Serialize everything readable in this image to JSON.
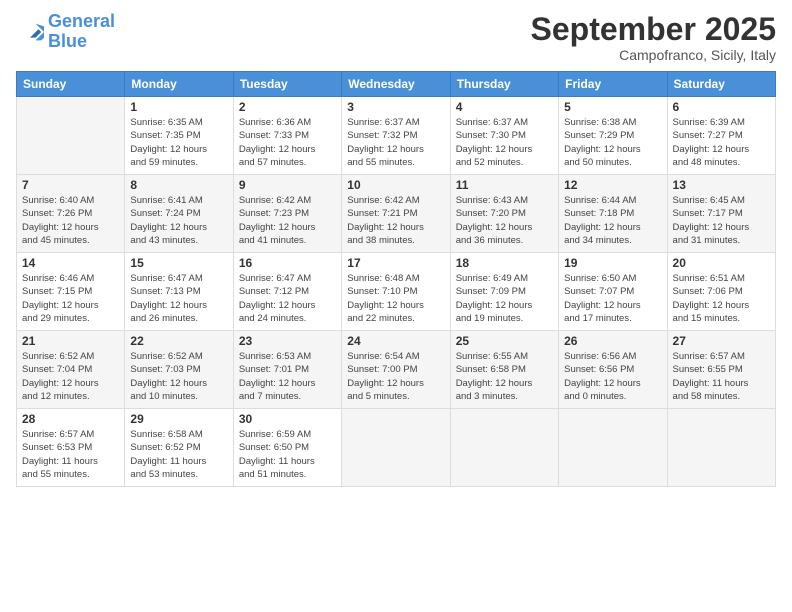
{
  "logo": {
    "line1": "General",
    "line2": "Blue"
  },
  "title": "September 2025",
  "location": "Campofranco, Sicily, Italy",
  "days_header": [
    "Sunday",
    "Monday",
    "Tuesday",
    "Wednesday",
    "Thursday",
    "Friday",
    "Saturday"
  ],
  "weeks": [
    [
      {
        "num": "",
        "info": ""
      },
      {
        "num": "1",
        "info": "Sunrise: 6:35 AM\nSunset: 7:35 PM\nDaylight: 12 hours\nand 59 minutes."
      },
      {
        "num": "2",
        "info": "Sunrise: 6:36 AM\nSunset: 7:33 PM\nDaylight: 12 hours\nand 57 minutes."
      },
      {
        "num": "3",
        "info": "Sunrise: 6:37 AM\nSunset: 7:32 PM\nDaylight: 12 hours\nand 55 minutes."
      },
      {
        "num": "4",
        "info": "Sunrise: 6:37 AM\nSunset: 7:30 PM\nDaylight: 12 hours\nand 52 minutes."
      },
      {
        "num": "5",
        "info": "Sunrise: 6:38 AM\nSunset: 7:29 PM\nDaylight: 12 hours\nand 50 minutes."
      },
      {
        "num": "6",
        "info": "Sunrise: 6:39 AM\nSunset: 7:27 PM\nDaylight: 12 hours\nand 48 minutes."
      }
    ],
    [
      {
        "num": "7",
        "info": "Sunrise: 6:40 AM\nSunset: 7:26 PM\nDaylight: 12 hours\nand 45 minutes."
      },
      {
        "num": "8",
        "info": "Sunrise: 6:41 AM\nSunset: 7:24 PM\nDaylight: 12 hours\nand 43 minutes."
      },
      {
        "num": "9",
        "info": "Sunrise: 6:42 AM\nSunset: 7:23 PM\nDaylight: 12 hours\nand 41 minutes."
      },
      {
        "num": "10",
        "info": "Sunrise: 6:42 AM\nSunset: 7:21 PM\nDaylight: 12 hours\nand 38 minutes."
      },
      {
        "num": "11",
        "info": "Sunrise: 6:43 AM\nSunset: 7:20 PM\nDaylight: 12 hours\nand 36 minutes."
      },
      {
        "num": "12",
        "info": "Sunrise: 6:44 AM\nSunset: 7:18 PM\nDaylight: 12 hours\nand 34 minutes."
      },
      {
        "num": "13",
        "info": "Sunrise: 6:45 AM\nSunset: 7:17 PM\nDaylight: 12 hours\nand 31 minutes."
      }
    ],
    [
      {
        "num": "14",
        "info": "Sunrise: 6:46 AM\nSunset: 7:15 PM\nDaylight: 12 hours\nand 29 minutes."
      },
      {
        "num": "15",
        "info": "Sunrise: 6:47 AM\nSunset: 7:13 PM\nDaylight: 12 hours\nand 26 minutes."
      },
      {
        "num": "16",
        "info": "Sunrise: 6:47 AM\nSunset: 7:12 PM\nDaylight: 12 hours\nand 24 minutes."
      },
      {
        "num": "17",
        "info": "Sunrise: 6:48 AM\nSunset: 7:10 PM\nDaylight: 12 hours\nand 22 minutes."
      },
      {
        "num": "18",
        "info": "Sunrise: 6:49 AM\nSunset: 7:09 PM\nDaylight: 12 hours\nand 19 minutes."
      },
      {
        "num": "19",
        "info": "Sunrise: 6:50 AM\nSunset: 7:07 PM\nDaylight: 12 hours\nand 17 minutes."
      },
      {
        "num": "20",
        "info": "Sunrise: 6:51 AM\nSunset: 7:06 PM\nDaylight: 12 hours\nand 15 minutes."
      }
    ],
    [
      {
        "num": "21",
        "info": "Sunrise: 6:52 AM\nSunset: 7:04 PM\nDaylight: 12 hours\nand 12 minutes."
      },
      {
        "num": "22",
        "info": "Sunrise: 6:52 AM\nSunset: 7:03 PM\nDaylight: 12 hours\nand 10 minutes."
      },
      {
        "num": "23",
        "info": "Sunrise: 6:53 AM\nSunset: 7:01 PM\nDaylight: 12 hours\nand 7 minutes."
      },
      {
        "num": "24",
        "info": "Sunrise: 6:54 AM\nSunset: 7:00 PM\nDaylight: 12 hours\nand 5 minutes."
      },
      {
        "num": "25",
        "info": "Sunrise: 6:55 AM\nSunset: 6:58 PM\nDaylight: 12 hours\nand 3 minutes."
      },
      {
        "num": "26",
        "info": "Sunrise: 6:56 AM\nSunset: 6:56 PM\nDaylight: 12 hours\nand 0 minutes."
      },
      {
        "num": "27",
        "info": "Sunrise: 6:57 AM\nSunset: 6:55 PM\nDaylight: 11 hours\nand 58 minutes."
      }
    ],
    [
      {
        "num": "28",
        "info": "Sunrise: 6:57 AM\nSunset: 6:53 PM\nDaylight: 11 hours\nand 55 minutes."
      },
      {
        "num": "29",
        "info": "Sunrise: 6:58 AM\nSunset: 6:52 PM\nDaylight: 11 hours\nand 53 minutes."
      },
      {
        "num": "30",
        "info": "Sunrise: 6:59 AM\nSunset: 6:50 PM\nDaylight: 11 hours\nand 51 minutes."
      },
      {
        "num": "",
        "info": ""
      },
      {
        "num": "",
        "info": ""
      },
      {
        "num": "",
        "info": ""
      },
      {
        "num": "",
        "info": ""
      }
    ]
  ]
}
